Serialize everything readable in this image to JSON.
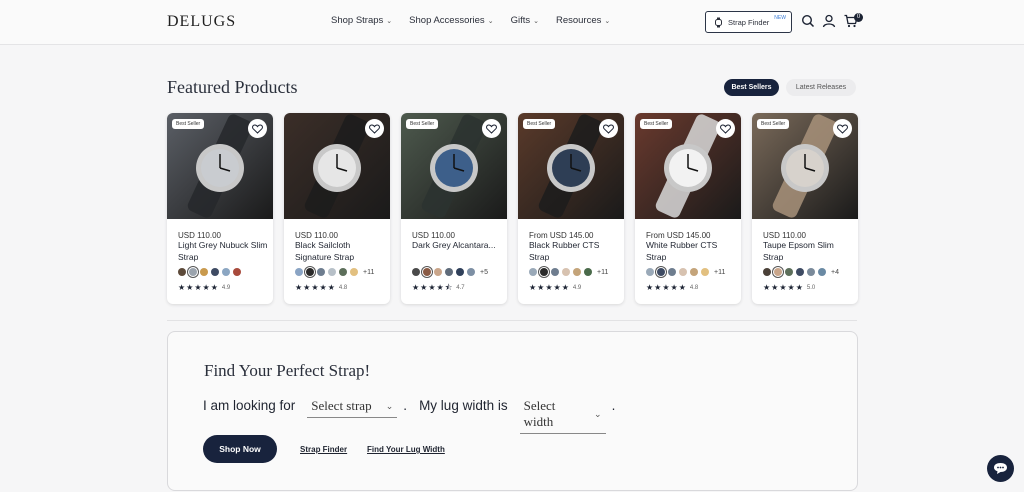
{
  "header": {
    "logo": "DELUGS",
    "nav": [
      {
        "label": "Shop Straps"
      },
      {
        "label": "Shop Accessories"
      },
      {
        "label": "Gifts"
      },
      {
        "label": "Resources"
      }
    ],
    "strap_finder_label": "Strap Finder",
    "strap_finder_badge": "NEW",
    "cart_count": "0"
  },
  "featured": {
    "title": "Featured Products",
    "tabs": [
      "Best Sellers",
      "Latest Releases"
    ],
    "active_tab": "Best Sellers"
  },
  "products": [
    {
      "badge": "Best Seller",
      "price": "USD 110.00",
      "name": "Light Grey Nubuck Slim Strap",
      "swatches": [
        "#5d4a3a",
        "#9aa3ad",
        "#c99a4e",
        "#3e4b63",
        "#8ba6c2",
        "#a84a3c"
      ],
      "more": "",
      "rating": "4.9",
      "stars": 5,
      "img": [
        "#5b5f66",
        "#c9ccd0",
        "#26282c"
      ]
    },
    {
      "badge": "",
      "price": "USD 110.00",
      "name": "Black Sailcloth Signature Strap",
      "swatches": [
        "#8aa4c4",
        "#2a2a2a",
        "#6e7d8f",
        "#b7c0c8",
        "#5c6e5a",
        "#e2c080"
      ],
      "more": "+11",
      "rating": "4.8",
      "stars": 5,
      "img": [
        "#3b2e28",
        "#e6e6e6",
        "#1c1c1c"
      ]
    },
    {
      "badge": "Best Seller",
      "price": "USD 110.00",
      "name": "Dark Grey Alcantara...",
      "swatches": [
        "#4a4a4a",
        "#8a5a44",
        "#c9a58a",
        "#5f6b7a",
        "#30405a",
        "#7d8fa4"
      ],
      "more": "+5",
      "rating": "4.7",
      "stars": 4.5,
      "img": [
        "#4e5a4e",
        "#3d5f8a",
        "#2c3230"
      ]
    },
    {
      "badge": "Best Seller",
      "price": "From USD 145.00",
      "name": "Black Rubber CTS Strap",
      "swatches": [
        "#9aa9b8",
        "#2a2a2a",
        "#6e7d8f",
        "#d7c2b0",
        "#c4a47a",
        "#4a6a4a"
      ],
      "more": "+11",
      "rating": "4.9",
      "stars": 5,
      "img": [
        "#5a3a2a",
        "#2e3e55",
        "#1c1c1c"
      ]
    },
    {
      "badge": "Best Seller",
      "price": "From USD 145.00",
      "name": "White Rubber CTS Strap",
      "swatches": [
        "#9aa9b8",
        "#3e4b63",
        "#6e7d8f",
        "#d7c2b0",
        "#c4a47a",
        "#e2c080"
      ],
      "more": "+11",
      "rating": "4.8",
      "stars": 5,
      "img": [
        "#6a3a2e",
        "#f2f2f2",
        "#d9d9d9"
      ]
    },
    {
      "badge": "Best Seller",
      "price": "USD 110.00",
      "name": "Taupe Epsom Slim Strap",
      "swatches": [
        "#4a4038",
        "#c9a58a",
        "#5c6e5a",
        "#3e4b63",
        "#7a8a9a",
        "#6a8aa4"
      ],
      "more": "+4",
      "rating": "5.0",
      "stars": 5,
      "img": [
        "#7a6a5a",
        "#d7d2cc",
        "#a8927a"
      ]
    }
  ],
  "finder": {
    "title": "Find Your Perfect Strap!",
    "prefix": "I am looking for",
    "select_strap": "Select strap",
    "dot1": ".",
    "middle": "My lug width is",
    "select_width": "Select width",
    "dot2": ".",
    "shop_now": "Shop Now",
    "link1": "Strap Finder",
    "link2": "Find Your Lug Width"
  },
  "colors": {
    "navy": "#18233d",
    "accent_new": "#3a7bd5"
  }
}
